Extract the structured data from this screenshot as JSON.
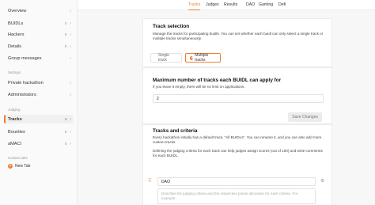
{
  "sidebar": {
    "items": [
      {
        "label": "Overview",
        "badge": ""
      },
      {
        "label": "BUIDLs",
        "badge": "0"
      },
      {
        "label": "Hackers",
        "badge": "0"
      },
      {
        "label": "Details",
        "badge": "0"
      },
      {
        "label": "Group messages",
        "badge": ""
      }
    ],
    "settings_heading": "Settings",
    "settings_items": [
      {
        "label": "Private hackathon"
      },
      {
        "label": "Administrators"
      }
    ],
    "judging_heading": "Judging",
    "judging_items": [
      {
        "label": "Tracks",
        "badge": "3"
      },
      {
        "label": "Bounties",
        "badge": "0"
      },
      {
        "label": "aMACI",
        "badge": "0"
      }
    ],
    "custom_heading": "Custom tabs",
    "new_tab": "New Tab"
  },
  "tabs": [
    {
      "label": "Tracks",
      "active": true
    },
    {
      "label": "Judges"
    },
    {
      "label": "Results"
    },
    {
      "label": "DAO"
    },
    {
      "label": "Gaming"
    },
    {
      "label": "Defi"
    }
  ],
  "track_selection": {
    "title": "Track selection",
    "description": "Manage the tracks for participating buidls. You can set whether each buidl can only select a single track or multiple tracks simultaneously.",
    "single": "Single track",
    "multiple": "Multiple tracks"
  },
  "max_tracks": {
    "title": "Maximum number of tracks each BUIDL can apply for",
    "description": "If you leave it empty, there will be no limit on applications.",
    "value": "2",
    "save": "Save Changes"
  },
  "criteria": {
    "title": "Tracks and criteria",
    "desc1": "Every hackathon initially has a default track, \"All BUIDLs\". You can rename it, and you can also add more custom tracks.",
    "desc2": "Defining the judging criteria for each track can help judges assign scores (out of 100) and write comments for each BUIDL.",
    "track_name": "DAO",
    "track_placeholder": "Describe the judging criteria and the respective points allocation for each criteria. For example:"
  }
}
